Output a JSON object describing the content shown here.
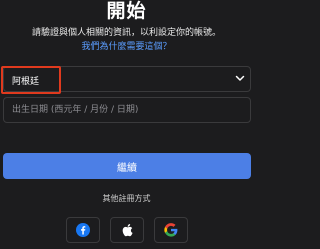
{
  "header": {
    "title": "開始",
    "subtitle": "請驗證與個人相關的資訊，以利設定你的帳號。",
    "why_link": "我們為什麼需要這個？"
  },
  "form": {
    "country_value": "阿根廷",
    "birthdate_placeholder": "出生日期 (西元年 / 月份 / 日期)"
  },
  "actions": {
    "continue_label": "繼續"
  },
  "social": {
    "label": "其他註冊方式",
    "providers": [
      "facebook-icon",
      "apple-icon",
      "google-icon"
    ]
  },
  "colors": {
    "background": "#1c1c1e",
    "accent": "#4c7fe6",
    "link": "#5b9dff",
    "highlight": "#e03a1e",
    "facebook": "#1877f2"
  }
}
